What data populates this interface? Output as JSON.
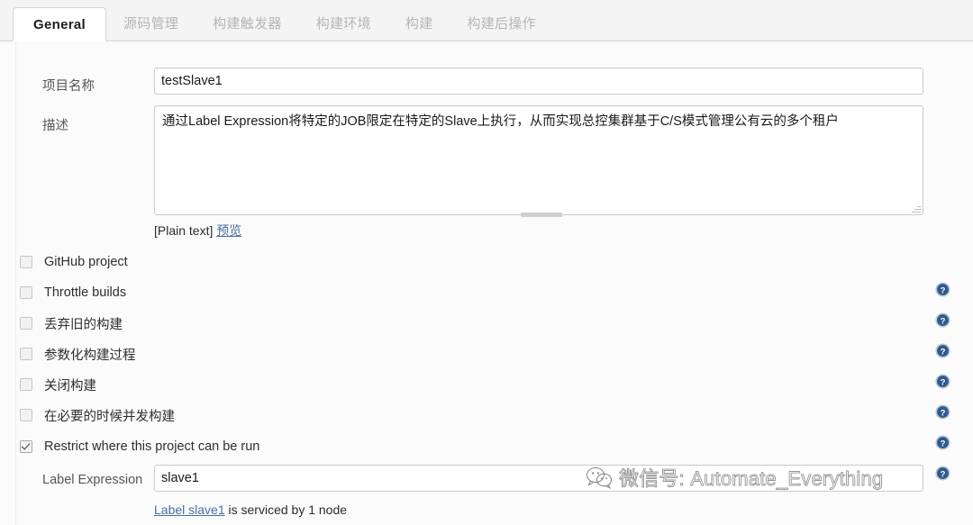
{
  "tabs": [
    {
      "label": "General",
      "active": true
    },
    {
      "label": "源码管理",
      "active": false
    },
    {
      "label": "构建触发器",
      "active": false
    },
    {
      "label": "构建环境",
      "active": false
    },
    {
      "label": "构建",
      "active": false
    },
    {
      "label": "构建后操作",
      "active": false
    }
  ],
  "fields": {
    "project_name": {
      "label": "项目名称",
      "value": "testSlave1"
    },
    "description": {
      "label": "描述",
      "value": "通过Label Expression将特定的JOB限定在特定的Slave上执行，从而实现总控集群基于C/S模式管理公有云的多个租户"
    },
    "plain_text_note": "[Plain text]",
    "preview_link": "预览",
    "label_expression": {
      "label": "Label Expression",
      "value": "slave1"
    },
    "label_status": {
      "link": "Label slave1",
      "rest": " is serviced by 1 node"
    }
  },
  "checkboxes": [
    {
      "label": "GitHub project",
      "checked": false,
      "help": false
    },
    {
      "label": "Throttle builds",
      "checked": false,
      "help": true
    },
    {
      "label": "丢弃旧的构建",
      "checked": false,
      "help": true
    },
    {
      "label": "参数化构建过程",
      "checked": false,
      "help": true
    },
    {
      "label": "关闭构建",
      "checked": false,
      "help": true
    },
    {
      "label": "在必要的时候并发构建",
      "checked": false,
      "help": true
    },
    {
      "label": "Restrict where this project can be run",
      "checked": true,
      "help": true
    }
  ],
  "icons": {
    "help": "help-question-circle-icon",
    "wechat": "wechat-logo-icon"
  },
  "watermark": {
    "text": "微信号: Automate_Everything"
  },
  "colors": {
    "accent_link": "#4a6f9e",
    "help_icon": "#2e5a8e",
    "page_bg": "#fbfbfb",
    "tab_bg": "#f4f4f4",
    "border": "#d4d4d4"
  }
}
